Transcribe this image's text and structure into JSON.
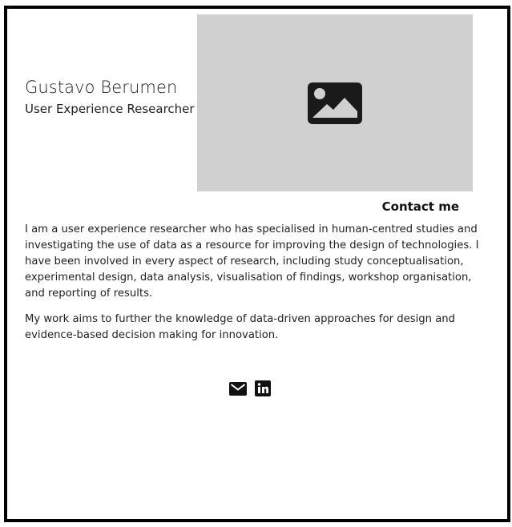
{
  "profile": {
    "name": "Gustavo Berumen",
    "role": "User Experience Researcher"
  },
  "hero": {
    "icon": "image-placeholder-icon",
    "background": "#d0d0d0"
  },
  "contact": {
    "label": "Contact me"
  },
  "bio": {
    "paragraphs": [
      "I am a user experience researcher who has specialised in human-centred studies and investigating the use of data as a resource for improving the design of technologies. I have been involved in every aspect of research, including study conceptualisation, experimental design, data analysis, visualisation of findings, workshop organisation, and reporting of results.",
      "My work aims to further the knowledge of data-driven approaches for design and evidence-based decision making for innovation."
    ]
  },
  "social": {
    "items": [
      {
        "icon": "envelope-icon"
      },
      {
        "icon": "linkedin-icon"
      }
    ]
  }
}
